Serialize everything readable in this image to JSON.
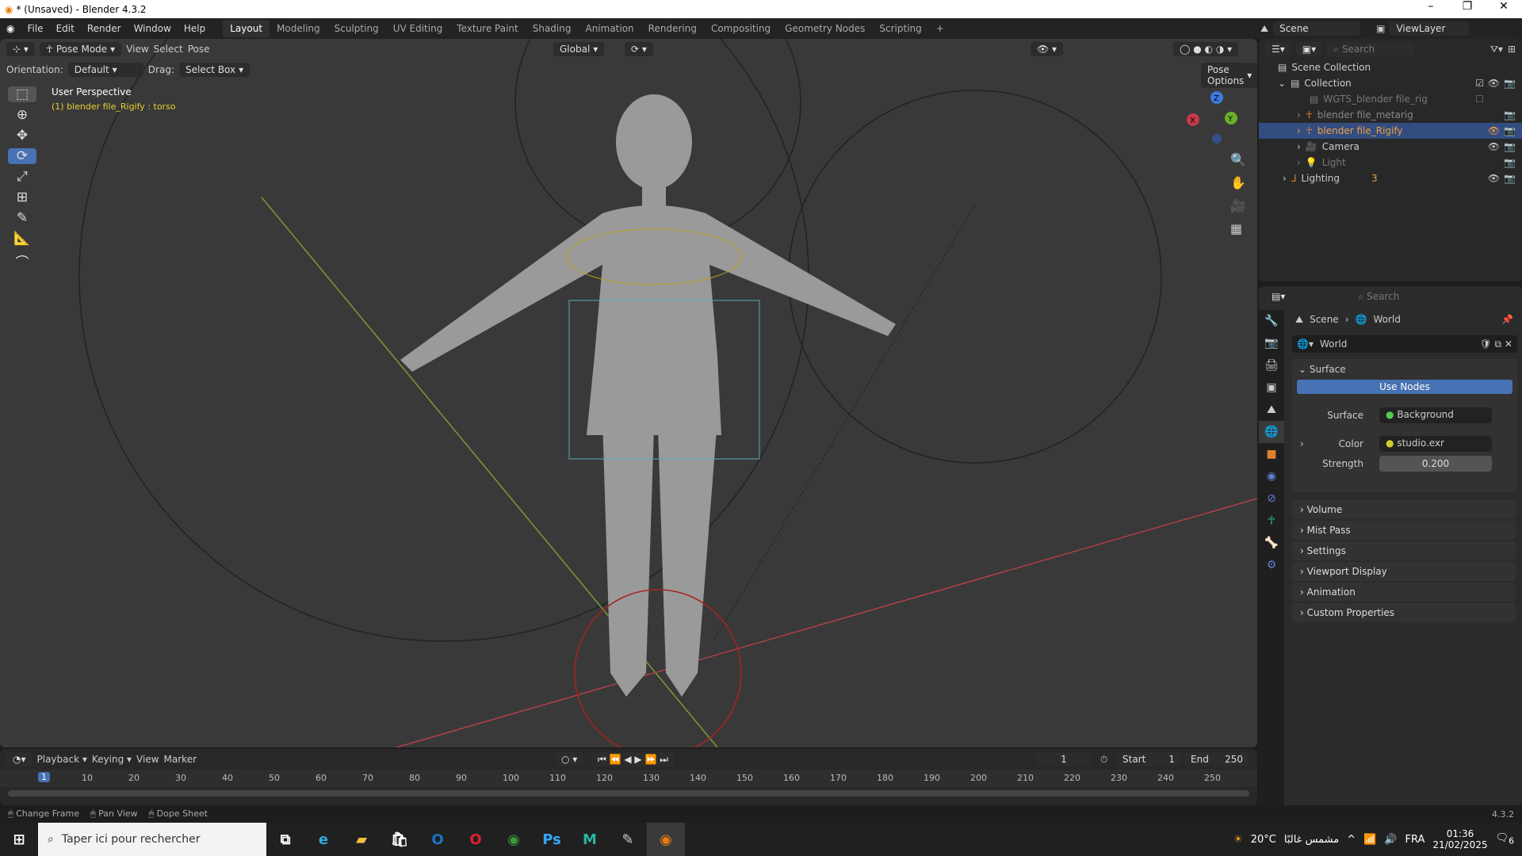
{
  "window": {
    "title": "* (Unsaved) - Blender 4.3.2",
    "controls": [
      "–",
      "❐",
      "✕"
    ]
  },
  "menu": [
    "File",
    "Edit",
    "Render",
    "Window",
    "Help"
  ],
  "workspaces": [
    "Layout",
    "Modeling",
    "Sculpting",
    "UV Editing",
    "Texture Paint",
    "Shading",
    "Animation",
    "Rendering",
    "Compositing",
    "Geometry Nodes",
    "Scripting",
    "+"
  ],
  "scene": {
    "scene_name": "Scene",
    "view_layer": "ViewLayer"
  },
  "viewport": {
    "mode": "Pose Mode",
    "menus": [
      "View",
      "Select",
      "Pose"
    ],
    "transform": "Global",
    "orientation_label": "Orientation:",
    "orientation": "Default",
    "drag_label": "Drag:",
    "drag": "Select Box",
    "pose_options": "Pose Options",
    "perspective": "User Perspective",
    "active": "(1) blender file_Rigify : torso",
    "gizmo": {
      "x": "X",
      "y": "Y",
      "z": "Z"
    }
  },
  "outliner": {
    "search_placeholder": "Search",
    "items": [
      {
        "label": "Scene Collection"
      },
      {
        "label": "Collection"
      },
      {
        "label": "WGTS_blender file_rig"
      },
      {
        "label": "blender file_metarig"
      },
      {
        "label": "blender file_Rigify"
      },
      {
        "label": "Camera"
      },
      {
        "label": "Light"
      },
      {
        "label": "Lighting",
        "badge": "3"
      }
    ]
  },
  "properties": {
    "search_placeholder": "Search",
    "breadcrumb": [
      "Scene",
      "World"
    ],
    "world_name": "World",
    "surface_panel": "Surface",
    "use_nodes": "Use Nodes",
    "surface_label": "Surface",
    "surface_value": "Background",
    "color_label": "Color",
    "color_value": "studio.exr",
    "strength_label": "Strength",
    "strength_value": "0.200",
    "panels": [
      "Volume",
      "Mist Pass",
      "Settings",
      "Viewport Display",
      "Animation",
      "Custom Properties"
    ]
  },
  "timeline": {
    "menus": [
      "Playback",
      "Keying",
      "View",
      "Marker"
    ],
    "current_frame": "1",
    "start_label": "Start",
    "start": "1",
    "end_label": "End",
    "end": "250",
    "ticks": [
      "10",
      "20",
      "30",
      "40",
      "50",
      "60",
      "70",
      "80",
      "90",
      "100",
      "110",
      "120",
      "130",
      "140",
      "150",
      "160",
      "170",
      "180",
      "190",
      "200",
      "210",
      "220",
      "230",
      "240",
      "250"
    ]
  },
  "status": {
    "items": [
      "Change Frame",
      "Pan View",
      "Dope Sheet"
    ],
    "version": "4.3.2"
  },
  "taskbar": {
    "search_placeholder": "Taper ici pour rechercher",
    "weather": "20°C",
    "weather_text": "مشمس غالبًا",
    "lang": "FRA",
    "time": "01:36",
    "date": "21/02/2025",
    "notif": "6"
  }
}
